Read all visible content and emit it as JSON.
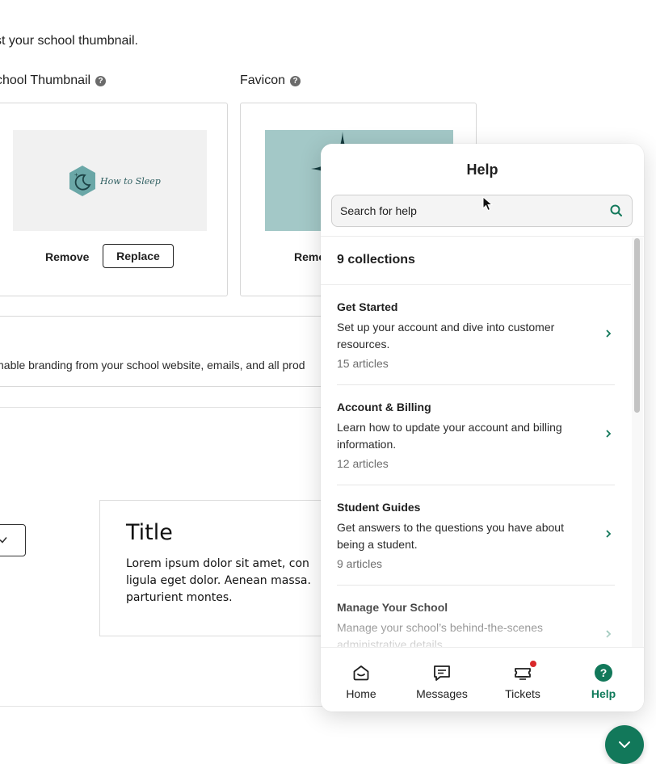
{
  "background": {
    "intro_text": "st your school thumbnail.",
    "thumbnail_label": "chool Thumbnail",
    "favicon_label": "Favicon",
    "logo_text": "How to Sleep",
    "remove_label": "Remove",
    "replace_label": "Replace",
    "favicon_remove_label": "Remo",
    "branding_text": "hable branding from your school website, emails, and all prod",
    "preview_title": "Title",
    "preview_body": [
      "Lorem ipsum dolor sit amet, con",
      "ligula eget dolor. Aenean massa.",
      "parturient montes."
    ]
  },
  "help_panel": {
    "title": "Help",
    "search": {
      "placeholder": "Search for help"
    },
    "collections_heading": "9 collections",
    "collections": [
      {
        "title": "Get Started",
        "description": "Set up your account and dive into customer resources.",
        "count": "15 articles"
      },
      {
        "title": "Account & Billing",
        "description": "Learn how to update your account and billing information.",
        "count": "12 articles"
      },
      {
        "title": "Student Guides",
        "description": "Get answers to the questions you have about being a student.",
        "count": "9 articles"
      },
      {
        "title": "Manage Your School",
        "description": "Manage your school’s behind-the-scenes administrative details.",
        "count": ""
      }
    ],
    "tabs": [
      {
        "label": "Home",
        "icon": "home-icon"
      },
      {
        "label": "Messages",
        "icon": "messages-icon"
      },
      {
        "label": "Tickets",
        "icon": "tickets-icon"
      },
      {
        "label": "Help",
        "icon": "help-icon"
      }
    ],
    "active_tab": "Help"
  },
  "colors": {
    "accent": "#12785a",
    "teal_preview": "#a3c8c7",
    "notification": "#d9292b"
  }
}
